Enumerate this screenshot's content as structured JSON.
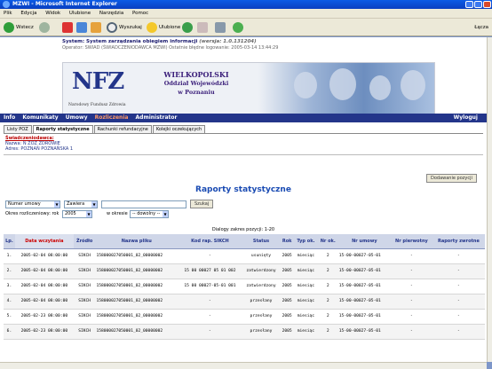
{
  "window": {
    "title": "MZWI - Microsoft Internet Explorer"
  },
  "menu": [
    "Plik",
    "Edycja",
    "Widok",
    "Ulubione",
    "Narzędzia",
    "Pomoc"
  ],
  "toolbar": {
    "back": "Wstecz",
    "search": "Wyszukaj",
    "favorites": "Ulubione",
    "address": "Łącza"
  },
  "system": {
    "line1": "System: System zarządzania obiegiem informacji",
    "line1_version": "(wersja: 1.0.131204)",
    "line2": "Operator: SWIAD (ŚWIADCZENIODAWCA MZWI) Ostatnie błędne logowanie: 2005-03-14 13:44:29"
  },
  "banner": {
    "logo": "NFZ",
    "logo_sub": "Narodowy Fundusz Zdrowia",
    "region1": "WIELKOPOLSKI",
    "region2": "Oddział Wojewódzki",
    "region3": "w Poznaniu"
  },
  "nav": {
    "items": [
      "Info",
      "Komunikaty",
      "Umowy",
      "Rozliczenia",
      "Administrator"
    ],
    "active": "Rozliczenia",
    "logout": "Wyloguj"
  },
  "tabs": [
    "Listy POZ",
    "Raporty statystyczne",
    "Rachunki refundacyjne",
    "Kolejki oczekujących"
  ],
  "provider": {
    "heading": "Świadczeniodawca:",
    "name": "Nazwa: N ZOZ ZDROWIE",
    "address": "Adres: POZNAŃ POZNAŃSKA 1"
  },
  "buttons": {
    "add": "Dodawanie pozycji",
    "search": "Szukaj"
  },
  "page_title": "Raporty statystyczne",
  "filter": {
    "field": "Numer umowy",
    "op": "Zawiera",
    "value": "",
    "year_label": "Okres rozliczeniowy: rok",
    "year": "2005",
    "month_label": "w okresie",
    "month": "-- dowolny --"
  },
  "range": "Dialogy zakres pozycji: 1-20",
  "table": {
    "columns": [
      "Lp.",
      "Data wczytania",
      "Źródło",
      "Nazwa pliku",
      "Kod rap. SIKCH",
      "Status",
      "Rok",
      "Typ ok.",
      "Nr ok.",
      "Nr umowy",
      "Nr pierwotny",
      "Raporty zwrotne"
    ],
    "rows": [
      [
        "1.",
        "2005-02-04 08:00:00",
        "SIKCH",
        "158000027050001_02_00000002",
        "-",
        "usunięty",
        "2005",
        "miesiąc",
        "2",
        "15-00-00027-05-01",
        "-",
        "-"
      ],
      [
        "2.",
        "2005-02-04 08:00:00",
        "SIKCH",
        "158000027050001_02_00000002",
        "15 00 00027 05 01 002",
        "zatwierdzony",
        "2005",
        "miesiąc",
        "2",
        "15-00-00027-05-01",
        "-",
        "-"
      ],
      [
        "3.",
        "2005-02-04 08:00:00",
        "SIKCH",
        "158000027050001_02_00000002",
        "15 00 00027-05-01 001",
        "zatwierdzony",
        "2005",
        "miesiąc",
        "2",
        "15-00-00027-05-01",
        "-",
        "-"
      ],
      [
        "4.",
        "2005-02-04 08:00:00",
        "SIKCH",
        "158000027050001_02_00000002",
        "-",
        "przesłany",
        "2005",
        "miesiąc",
        "2",
        "15-00-00027-05-01",
        "-",
        "-"
      ],
      [
        "5.",
        "2005-02-23 08:00:00",
        "SIKCH",
        "158000027050001_02_00000002",
        "-",
        "przesłany",
        "2005",
        "miesiąc",
        "2",
        "15-00-00027-05-01",
        "-",
        "-"
      ],
      [
        "6.",
        "2005-02-23 08:00:00",
        "SIKCH",
        "158000027050001_02_00000002",
        "-",
        "przesłany",
        "2005",
        "miesiąc",
        "2",
        "15-00-00027-05-01",
        "-",
        "-"
      ]
    ]
  },
  "colors": {
    "nav_bg": "#23358a",
    "accent": "#ff9966",
    "title": "#1a4bb3"
  }
}
